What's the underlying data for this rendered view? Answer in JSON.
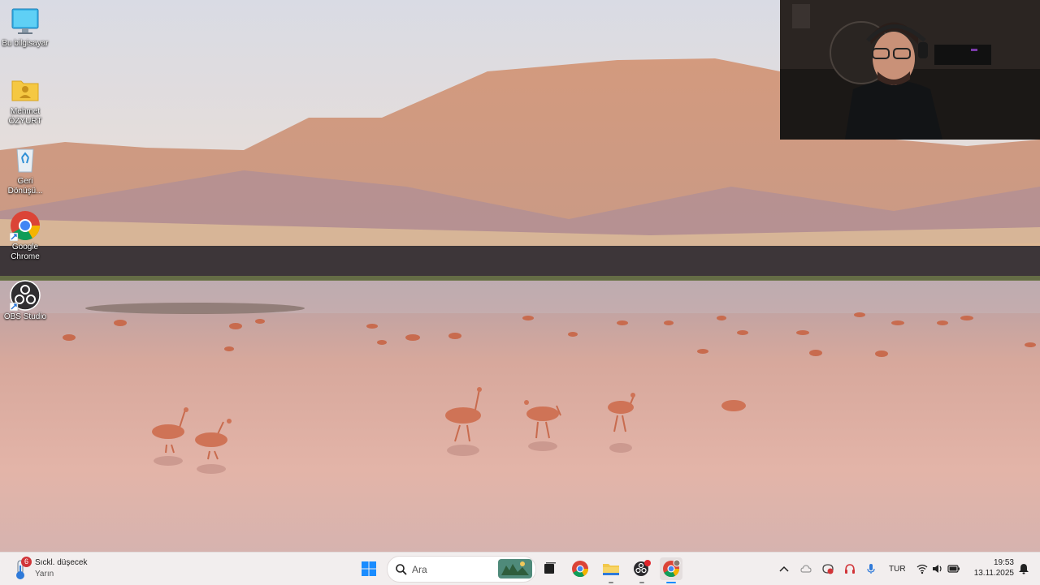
{
  "desktop": {
    "icons": [
      {
        "label": "Bu bilgisayar",
        "icon": "monitor-icon"
      },
      {
        "label": "Mehmet\nÖZYURT",
        "icon": "user-folder-icon"
      },
      {
        "label": "Geri\nDönüşü...",
        "icon": "recycle-bin-icon"
      },
      {
        "label": "Google\nChrome",
        "icon": "chrome-icon"
      },
      {
        "label": "OBS Studio",
        "icon": "obs-icon"
      }
    ]
  },
  "taskbar": {
    "weather": {
      "title": "Sıckl. düşecek",
      "subtitle": "Yarın",
      "badge": "6"
    },
    "search": {
      "placeholder": "Ara"
    },
    "tray": {
      "language": "TUR",
      "time": "19:53",
      "date": "13.11.2025"
    }
  },
  "colors": {
    "taskbar_bg": "#f2eeee",
    "start_blue": "#1a8cff",
    "chrome_red": "#db4437",
    "chrome_yellow": "#f4b400",
    "chrome_green": "#0f9d58",
    "chrome_blue": "#4285f4"
  }
}
